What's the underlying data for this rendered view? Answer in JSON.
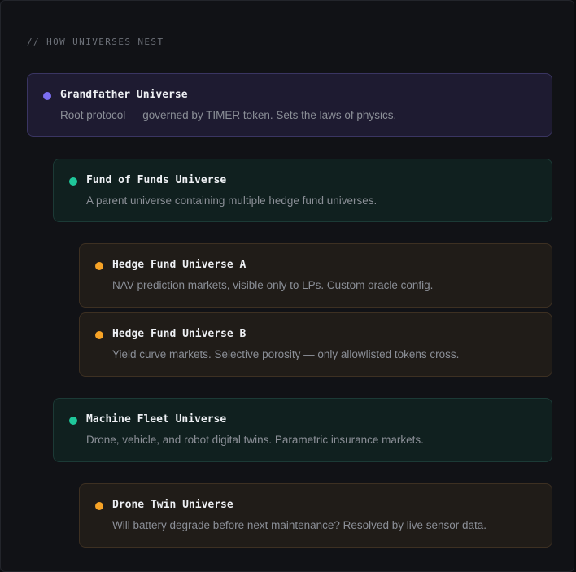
{
  "section_label": "// HOW UNIVERSES NEST",
  "colors": {
    "grandfather": "#7c6ff2",
    "fund": "#1fc79a",
    "hedge": "#f7a326"
  },
  "universes": [
    {
      "title": "Grandfather Universe",
      "description": "Root protocol — governed by TIMER token. Sets the laws of physics."
    },
    {
      "title": "Fund of Funds Universe",
      "description": "A parent universe containing multiple hedge fund universes."
    },
    {
      "title": "Hedge Fund Universe A",
      "description": "NAV prediction markets, visible only to LPs. Custom oracle config."
    },
    {
      "title": "Hedge Fund Universe B",
      "description": "Yield curve markets. Selective porosity — only allowlisted tokens cross."
    },
    {
      "title": "Machine Fleet Universe",
      "description": "Drone, vehicle, and robot digital twins. Parametric insurance markets."
    },
    {
      "title": "Drone Twin Universe",
      "description": "Will battery degrade before next maintenance? Resolved by live sensor data."
    }
  ]
}
